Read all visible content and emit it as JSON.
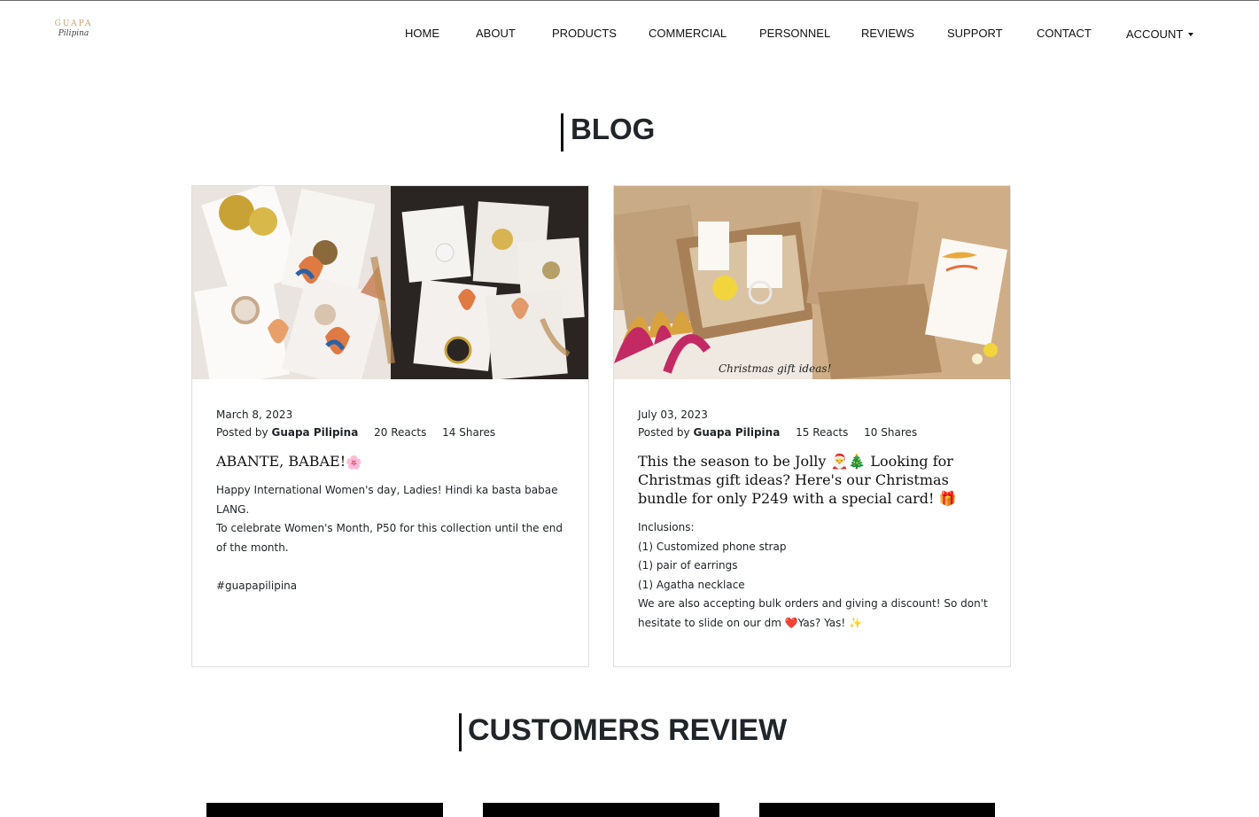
{
  "logo": {
    "brand": "GUAPA",
    "script": "Pilipina"
  },
  "nav": {
    "items": [
      "HOME",
      "ABOUT",
      "PRODUCTS",
      "COMMERCIAL",
      "PERSONNEL",
      "REVIEWS",
      "SUPPORT",
      "CONTACT"
    ],
    "account": "ACCOUNT"
  },
  "blog": {
    "title": "BLOG",
    "posts": [
      {
        "date": "March 8, 2023",
        "posted_by": "Posted by",
        "author": "Guapa Pilipina",
        "reacts": "20 Reacts",
        "shares": "14 Shares",
        "title": "ABANTE, BABAE!",
        "title_emoji": "🌸",
        "body": [
          "Happy International Women's day, Ladies! Hindi ka basta babae LANG.",
          "To celebrate Women's Month, P50 for this collection until the end of the month.",
          "",
          "#guapapilipina"
        ]
      },
      {
        "date": "July 03, 2023",
        "posted_by": "Posted by",
        "author": "Guapa Pilipina",
        "reacts": "15 Reacts",
        "shares": "10 Shares",
        "title": "This the season to be Jolly 🎅🎄 Looking for Christmas gift ideas? Here's our Christmas bundle for only P249 with a special card! 🎁",
        "body": [
          "Inclusions:",
          "(1) Customized phone strap",
          "(1) pair of earrings",
          "(1) Agatha necklace",
          "We are also accepting bulk orders and giving a discount! So don't hesitate to slide on our dm ❤️Yas? Yas! ✨"
        ],
        "photo_caption": "Christmas gift ideas!"
      }
    ]
  },
  "reviews": {
    "title": "CUSTOMERS REVIEW"
  },
  "colors": {
    "accent_gold": "#c9a27a",
    "text": "#212529",
    "border": "#dfdfdf"
  }
}
